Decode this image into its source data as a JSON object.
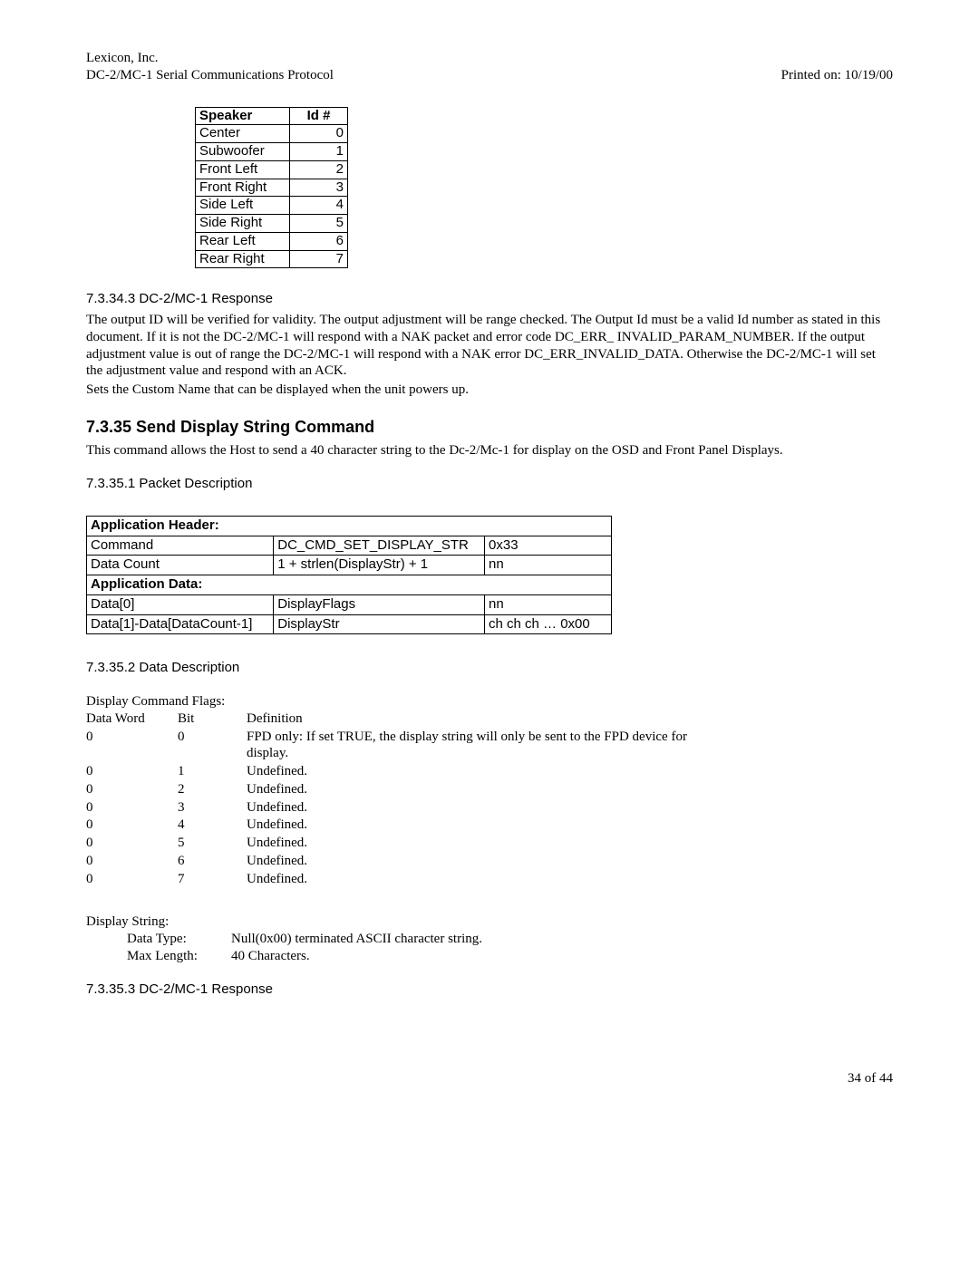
{
  "header": {
    "company": "Lexicon, Inc.",
    "title": "DC-2/MC-1 Serial Communications Protocol",
    "printed": "Printed on: 10/19/00"
  },
  "speaker_table": {
    "headers": {
      "speaker": "Speaker",
      "id": "Id #"
    },
    "rows": [
      {
        "speaker": "Center",
        "id": "0"
      },
      {
        "speaker": "Subwoofer",
        "id": "1"
      },
      {
        "speaker": "Front Left",
        "id": "2"
      },
      {
        "speaker": "Front Right",
        "id": "3"
      },
      {
        "speaker": "Side Left",
        "id": "4"
      },
      {
        "speaker": "Side Right",
        "id": "5"
      },
      {
        "speaker": "Rear Left",
        "id": "6"
      },
      {
        "speaker": "Rear Right",
        "id": "7"
      }
    ]
  },
  "sec_73343": {
    "heading": "7.3.34.3  DC-2/MC-1 Response",
    "body": "The output ID will be verified for validity.  The output adjustment will be range checked. The Output Id must be a valid Id number as stated in this document.  If it is not the DC-2/MC-1 will respond with a NAK packet and error code DC_ERR_ INVALID_PARAM_NUMBER.  If the output adjustment value is out of range the DC-2/MC-1 will respond with a NAK error DC_ERR_INVALID_DATA.  Otherwise the DC-2/MC-1 will set the adjustment value and respond with an ACK.",
    "body2": "Sets the Custom Name that can be displayed when the  unit powers up."
  },
  "sec_7335": {
    "heading": "7.3.35  Send Display String Command",
    "body": "This command allows the Host to send a 40 character string to the Dc-2/Mc-1 for display on the OSD and Front Panel Displays."
  },
  "sec_73351": {
    "heading": "7.3.35.1  Packet Description"
  },
  "packet_table": {
    "app_header": "Application Header:",
    "command_row": {
      "c1": "Command",
      "c2": "DC_CMD_SET_DISPLAY_STR",
      "c3": "0x33"
    },
    "datacount_row": {
      "c1": "Data Count",
      "c2": "1 + strlen(DisplayStr) + 1",
      "c3": "nn"
    },
    "app_data": "Application Data:",
    "data0_row": {
      "c1": "Data[0]",
      "c2": "DisplayFlags",
      "c3": "nn"
    },
    "datan_row": {
      "c1": "Data[1]-Data[DataCount-1]",
      "c2": "DisplayStr",
      "c3": "ch ch ch … 0x00"
    }
  },
  "sec_73352": {
    "heading": "7.3.35.2  Data Description",
    "flags_label": "Display Command Flags:",
    "flags_header": {
      "dw": "Data Word",
      "bit": "Bit",
      "def": "Definition"
    },
    "flags_rows": [
      {
        "dw": "0",
        "bit": "0",
        "def": "FPD only: If set TRUE, the display string will only be sent to the FPD device for display."
      },
      {
        "dw": "0",
        "bit": "1",
        "def": "Undefined."
      },
      {
        "dw": "0",
        "bit": "2",
        "def": "Undefined."
      },
      {
        "dw": "0",
        "bit": "3",
        "def": "Undefined."
      },
      {
        "dw": "0",
        "bit": "4",
        "def": "Undefined."
      },
      {
        "dw": "0",
        "bit": "5",
        "def": "Undefined."
      },
      {
        "dw": "0",
        "bit": "6",
        "def": "Undefined."
      },
      {
        "dw": "0",
        "bit": "7",
        "def": "Undefined."
      }
    ],
    "display_string_label": "Display String:",
    "data_type_label": "Data Type:",
    "data_type_value": "Null(0x00) terminated ASCII character string.",
    "max_length_label": "Max Length:",
    "max_length_value": "40 Characters."
  },
  "sec_73353": {
    "heading": "7.3.35.3  DC-2/MC-1 Response"
  },
  "footer": "34 of 44"
}
